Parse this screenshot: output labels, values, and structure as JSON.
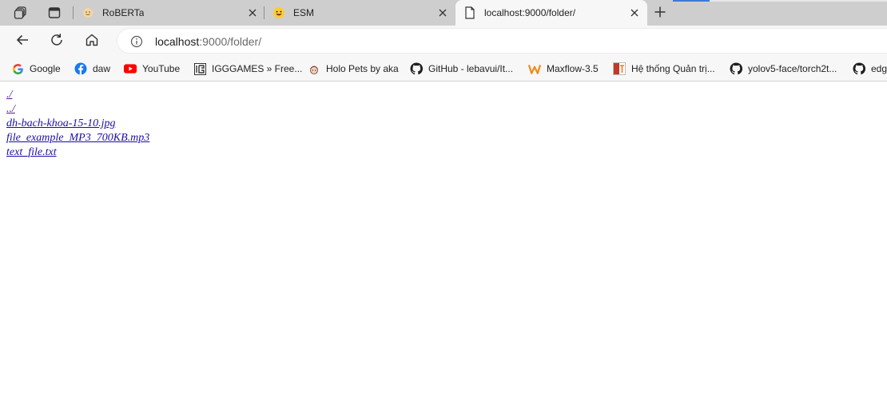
{
  "tabs": [
    {
      "title": "RoBERTa",
      "icon": "hugging-face-icon",
      "active": false
    },
    {
      "title": "ESM",
      "icon": "hugging-face-icon",
      "active": false
    },
    {
      "title": "localhost:9000/folder/",
      "icon": "page-icon",
      "active": true
    }
  ],
  "toolbar": {
    "url_host": "localhost",
    "url_rest": ":9000/folder/"
  },
  "bookmarks": [
    {
      "label": "Google",
      "icon": "google-icon"
    },
    {
      "label": "daw",
      "icon": "facebook-icon"
    },
    {
      "label": "YouTube",
      "icon": "youtube-icon"
    },
    {
      "label": "IGGGAMES » Free...",
      "icon": "igggames-icon"
    },
    {
      "label": "Holo Pets by aka",
      "icon": "holo-pets-icon"
    },
    {
      "label": "GitHub - lebavui/It...",
      "icon": "github-icon"
    },
    {
      "label": "Maxflow-3.5",
      "icon": "maxflow-icon"
    },
    {
      "label": "Hệ thống Quản trị...",
      "icon": "ht-icon"
    },
    {
      "label": "yolov5-face/torch2t...",
      "icon": "github-icon"
    },
    {
      "label": "edg",
      "icon": "github-icon"
    }
  ],
  "listing": [
    "./",
    "../",
    "dh-bach-khoa-15-10.jpg",
    "file_example_MP3_700KB.mp3",
    "text_file.txt"
  ]
}
